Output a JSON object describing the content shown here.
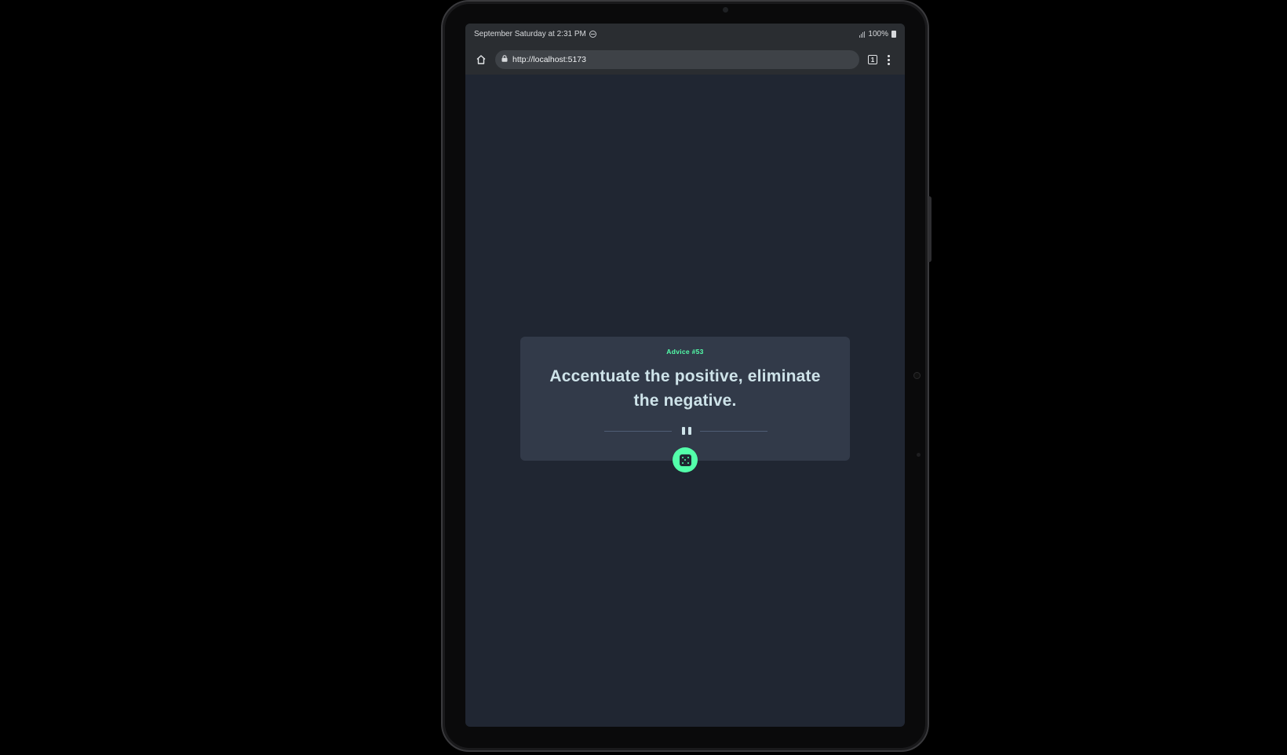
{
  "status_bar": {
    "datetime": "September Saturday at 2:31 PM",
    "battery": "100%"
  },
  "browser": {
    "url": "http://localhost:5173",
    "tab_count": "1"
  },
  "advice": {
    "id_label": "Advice #53",
    "quote": "Accentuate the positive, eliminate the negative."
  },
  "colors": {
    "accent": "#53ffaa",
    "card": "#323a49",
    "background": "#202632",
    "quote_text": "#cee3e9"
  },
  "icons": {
    "home": "home-icon",
    "lock": "lock-icon",
    "tabs": "tabs-icon",
    "menu": "more-vert-icon",
    "divider": "pause-icon",
    "generate": "dice-icon"
  }
}
